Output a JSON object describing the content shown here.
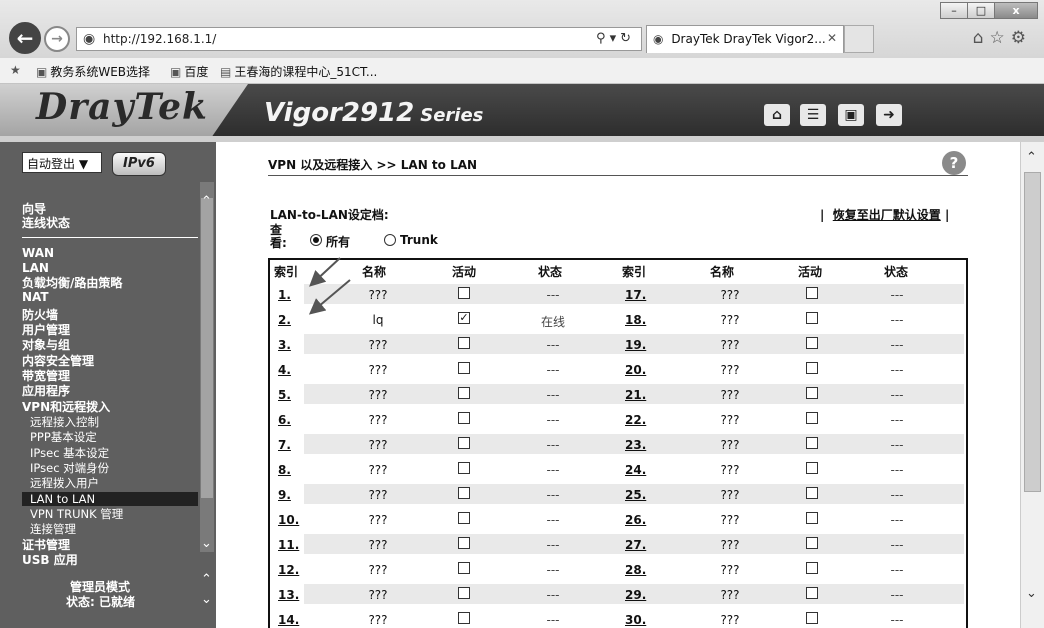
{
  "browser": {
    "url": "http://192.168.1.1/",
    "tab_title": "DrayTek DrayTek Vigor2...",
    "window_buttons": [
      "–",
      "□",
      "x"
    ],
    "favorites": [
      "教务系统WEB选择",
      "百度",
      "王春海的课程中心_51CT..."
    ]
  },
  "header": {
    "logo": "DrayTek",
    "model": "Vigor2912",
    "series": "Series",
    "icons": [
      "home-icon",
      "sliders-icon",
      "save-icon",
      "logout-icon"
    ]
  },
  "sidebar": {
    "logout_select": "自动登出",
    "ipv6_badge": "IPv6",
    "items": [
      {
        "label": "向导"
      },
      {
        "label": "连线状态"
      },
      {
        "label": "WAN"
      },
      {
        "label": "LAN"
      },
      {
        "label": "负载均衡/路由策略"
      },
      {
        "label": "NAT"
      },
      {
        "label": "防火墙"
      },
      {
        "label": "用户管理"
      },
      {
        "label": "对象与组"
      },
      {
        "label": "内容安全管理"
      },
      {
        "label": "带宽管理"
      },
      {
        "label": "应用程序"
      },
      {
        "label": "VPN和远程拨入"
      },
      {
        "label": "远程接入控制"
      },
      {
        "label": "PPP基本设定"
      },
      {
        "label": "IPsec 基本设定"
      },
      {
        "label": "IPsec 对端身份"
      },
      {
        "label": "远程拨入用户"
      },
      {
        "label": "LAN to LAN"
      },
      {
        "label": "VPN TRUNK 管理"
      },
      {
        "label": "连接管理"
      },
      {
        "label": "证书管理"
      },
      {
        "label": "USB 应用"
      }
    ],
    "admin_mode": "管理员模式",
    "status": "状态: 已就绪"
  },
  "content": {
    "breadcrumb": "VPN 以及远程接入 >> LAN to LAN",
    "profile_heading": "LAN-to-LAN设定档:",
    "restore_link": "恢复至出厂默认设置",
    "view_label": "查看:",
    "radio_all": "所有",
    "radio_trunk": "Trunk",
    "columns": [
      "索引",
      "名称",
      "活动",
      "状态",
      "索引",
      "名称",
      "活动",
      "状态"
    ],
    "rows": [
      {
        "l_idx": "1.",
        "l_name": "???",
        "l_active": false,
        "l_status": "---",
        "r_idx": "17.",
        "r_name": "???",
        "r_active": false,
        "r_status": "---"
      },
      {
        "l_idx": "2.",
        "l_name": "lq",
        "l_active": true,
        "l_status": "在线",
        "r_idx": "18.",
        "r_name": "???",
        "r_active": false,
        "r_status": "---"
      },
      {
        "l_idx": "3.",
        "l_name": "???",
        "l_active": false,
        "l_status": "---",
        "r_idx": "19.",
        "r_name": "???",
        "r_active": false,
        "r_status": "---"
      },
      {
        "l_idx": "4.",
        "l_name": "???",
        "l_active": false,
        "l_status": "---",
        "r_idx": "20.",
        "r_name": "???",
        "r_active": false,
        "r_status": "---"
      },
      {
        "l_idx": "5.",
        "l_name": "???",
        "l_active": false,
        "l_status": "---",
        "r_idx": "21.",
        "r_name": "???",
        "r_active": false,
        "r_status": "---"
      },
      {
        "l_idx": "6.",
        "l_name": "???",
        "l_active": false,
        "l_status": "---",
        "r_idx": "22.",
        "r_name": "???",
        "r_active": false,
        "r_status": "---"
      },
      {
        "l_idx": "7.",
        "l_name": "???",
        "l_active": false,
        "l_status": "---",
        "r_idx": "23.",
        "r_name": "???",
        "r_active": false,
        "r_status": "---"
      },
      {
        "l_idx": "8.",
        "l_name": "???",
        "l_active": false,
        "l_status": "---",
        "r_idx": "24.",
        "r_name": "???",
        "r_active": false,
        "r_status": "---"
      },
      {
        "l_idx": "9.",
        "l_name": "???",
        "l_active": false,
        "l_status": "---",
        "r_idx": "25.",
        "r_name": "???",
        "r_active": false,
        "r_status": "---"
      },
      {
        "l_idx": "10.",
        "l_name": "???",
        "l_active": false,
        "l_status": "---",
        "r_idx": "26.",
        "r_name": "???",
        "r_active": false,
        "r_status": "---"
      },
      {
        "l_idx": "11.",
        "l_name": "???",
        "l_active": false,
        "l_status": "---",
        "r_idx": "27.",
        "r_name": "???",
        "r_active": false,
        "r_status": "---"
      },
      {
        "l_idx": "12.",
        "l_name": "???",
        "l_active": false,
        "l_status": "---",
        "r_idx": "28.",
        "r_name": "???",
        "r_active": false,
        "r_status": "---"
      },
      {
        "l_idx": "13.",
        "l_name": "???",
        "l_active": false,
        "l_status": "---",
        "r_idx": "29.",
        "r_name": "???",
        "r_active": false,
        "r_status": "---"
      },
      {
        "l_idx": "14.",
        "l_name": "???",
        "l_active": false,
        "l_status": "---",
        "r_idx": "30.",
        "r_name": "???",
        "r_active": false,
        "r_status": "---"
      }
    ]
  },
  "colors": {
    "sidebar_bg": "#5f5f5f",
    "header_bg": "#2a2a2a",
    "active_item_bg": "#222222",
    "row_stripe": "#e9e9e9"
  }
}
